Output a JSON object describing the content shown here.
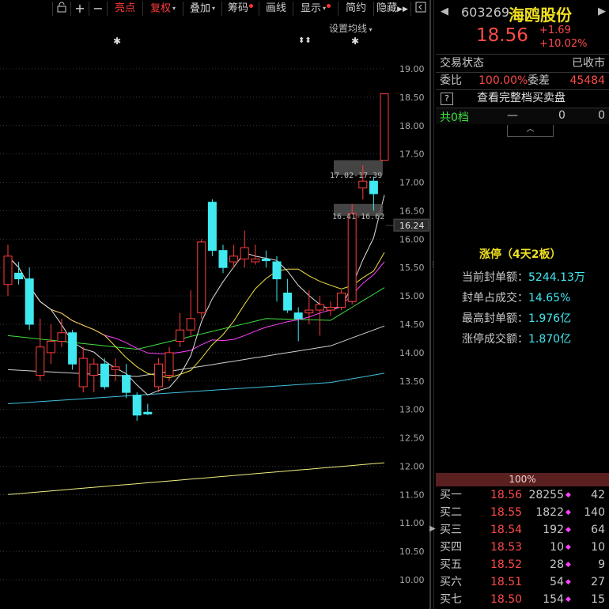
{
  "toolbar": {
    "items": [
      {
        "label": "亮点",
        "color": "red"
      },
      {
        "label": "复权",
        "color": "red",
        "caret": true
      },
      {
        "label": "叠加",
        "caret": true
      },
      {
        "label": "筹码",
        "dot": true
      },
      {
        "label": "画线"
      },
      {
        "label": "显示",
        "caret": true,
        "dot": true
      },
      {
        "label": "简约"
      },
      {
        "label": "隐藏"
      }
    ],
    "icons": [
      "lock-icon",
      "plus-icon",
      "minus-icon",
      "double-arrow-right-icon",
      "collapse-icon"
    ],
    "ma_settings": "设置均线"
  },
  "chart_data": {
    "type": "candlestick",
    "y_axis_ticks": [
      19.0,
      18.5,
      18.0,
      17.5,
      17.0,
      16.5,
      16.0,
      15.5,
      15.0,
      14.5,
      14.0,
      13.5,
      13.0,
      12.5,
      12.0,
      11.5,
      11.0,
      10.5,
      10.0
    ],
    "y_axis_labels": [
      "19.00",
      "18.50",
      "18.00",
      "17.50",
      "17.00",
      "16.50",
      "16.00",
      "15.50",
      "15.00",
      "14.50",
      "14.00",
      "13.50",
      "13.00",
      "12.50",
      "12.00",
      "11.50",
      "11.00",
      "10.50",
      "10.00"
    ],
    "current_price_label": "16.24",
    "ylim": [
      9.7,
      19.4
    ],
    "annotations": [
      {
        "text": "17.02-17.39"
      },
      {
        "text": "16.41-16.62"
      }
    ],
    "candles": [
      {
        "o": 15.2,
        "c": 15.7,
        "h": 15.9,
        "l": 15.0
      },
      {
        "o": 15.4,
        "c": 15.3,
        "h": 15.6,
        "l": 15.2
      },
      {
        "o": 15.3,
        "c": 14.5,
        "h": 15.5,
        "l": 14.4
      },
      {
        "o": 13.6,
        "c": 14.1,
        "h": 14.6,
        "l": 13.5
      },
      {
        "o": 14.0,
        "c": 14.2,
        "h": 14.5,
        "l": 13.8
      },
      {
        "o": 14.2,
        "c": 14.35,
        "h": 14.6,
        "l": 14.1
      },
      {
        "o": 14.35,
        "c": 13.8,
        "h": 14.4,
        "l": 13.7
      },
      {
        "o": 13.4,
        "c": 13.9,
        "h": 14.1,
        "l": 13.3
      },
      {
        "o": 13.6,
        "c": 13.8,
        "h": 13.9,
        "l": 13.3
      },
      {
        "o": 13.8,
        "c": 13.4,
        "h": 13.9,
        "l": 13.35
      },
      {
        "o": 13.7,
        "c": 13.75,
        "h": 13.9,
        "l": 13.5
      },
      {
        "o": 13.6,
        "c": 13.3,
        "h": 13.8,
        "l": 13.2
      },
      {
        "o": 13.25,
        "c": 12.9,
        "h": 13.3,
        "l": 12.8
      },
      {
        "o": 12.95,
        "c": 12.92,
        "h": 13.1,
        "l": 12.9
      },
      {
        "o": 13.4,
        "c": 13.8,
        "h": 13.9,
        "l": 13.3
      },
      {
        "o": 13.6,
        "c": 14.0,
        "h": 14.1,
        "l": 13.5
      },
      {
        "o": 14.2,
        "c": 14.4,
        "h": 14.7,
        "l": 14.1
      },
      {
        "o": 14.4,
        "c": 14.6,
        "h": 15.1,
        "l": 14.3
      },
      {
        "o": 14.7,
        "c": 15.95,
        "h": 16.0,
        "l": 14.6
      },
      {
        "o": 16.65,
        "c": 15.8,
        "h": 16.7,
        "l": 15.7
      },
      {
        "o": 15.8,
        "c": 15.5,
        "h": 15.9,
        "l": 15.4
      },
      {
        "o": 15.6,
        "c": 15.7,
        "h": 15.9,
        "l": 15.5
      },
      {
        "o": 15.65,
        "c": 15.85,
        "h": 16.15,
        "l": 15.5
      },
      {
        "o": 15.6,
        "c": 15.65,
        "h": 15.9,
        "l": 15.55
      },
      {
        "o": 15.65,
        "c": 15.62,
        "h": 15.8,
        "l": 15.5
      },
      {
        "o": 15.6,
        "c": 15.3,
        "h": 15.7,
        "l": 14.9
      },
      {
        "o": 15.05,
        "c": 14.75,
        "h": 15.3,
        "l": 14.7
      },
      {
        "o": 14.7,
        "c": 14.6,
        "h": 14.8,
        "l": 14.2
      },
      {
        "o": 14.7,
        "c": 14.75,
        "h": 15.1,
        "l": 14.5
      },
      {
        "o": 14.75,
        "c": 14.85,
        "h": 15.0,
        "l": 14.3
      },
      {
        "o": 14.75,
        "c": 14.8,
        "h": 14.9,
        "l": 14.65
      },
      {
        "o": 14.8,
        "c": 15.05,
        "h": 15.1,
        "l": 14.75
      },
      {
        "o": 14.9,
        "c": 16.45,
        "h": 16.62,
        "l": 14.85
      },
      {
        "o": 16.9,
        "c": 17.02,
        "h": 17.3,
        "l": 16.7
      },
      {
        "o": 17.02,
        "c": 16.8,
        "h": 17.1,
        "l": 16.5
      },
      {
        "o": 17.39,
        "c": 18.56,
        "h": 18.56,
        "l": 17.39
      }
    ],
    "gaps": [
      {
        "low": 17.13,
        "high": 17.39
      },
      {
        "low": 16.41,
        "high": 16.62
      }
    ]
  },
  "stock": {
    "code": "603269",
    "name": "海鸥股份",
    "price": "18.56",
    "change": "+1.69",
    "change_pct": "+10.02%"
  },
  "panel": {
    "trade_status_label": "交易状态",
    "trade_status_value": "已收市",
    "weibi_label": "委比",
    "weibi_value": "100.00%",
    "weicha_label": "委差",
    "weicha_value": "45484",
    "view_full_label": "查看完整档买卖盘",
    "ask_icon": "?",
    "total_label": "共0档",
    "total_dash": "—",
    "total_v1": "0",
    "total_v2": "0",
    "limit_title": "涨停（4天2板）",
    "stats": [
      {
        "k": "当前封单额：",
        "v": "5244.13万"
      },
      {
        "k": "封单占成交：",
        "v": "14.65%"
      },
      {
        "k": "最高封单额：",
        "v": "1.976亿"
      },
      {
        "k": "涨停成交额：",
        "v": "1.870亿"
      }
    ],
    "bar_pct": "100%",
    "bids": [
      {
        "name": "买一",
        "price": "18.56",
        "vol": "28255",
        "mark": "◆",
        "cnt": "42"
      },
      {
        "name": "买二",
        "price": "18.55",
        "vol": "1822",
        "mark": "◆",
        "cnt": "140"
      },
      {
        "name": "买三",
        "price": "18.54",
        "vol": "192",
        "mark": "◆",
        "cnt": "64"
      },
      {
        "name": "买四",
        "price": "18.53",
        "vol": "10",
        "mark": "◆",
        "cnt": "10"
      },
      {
        "name": "买五",
        "price": "18.52",
        "vol": "28",
        "mark": "◆",
        "cnt": "9"
      },
      {
        "name": "买六",
        "price": "18.51",
        "vol": "54",
        "mark": "◆",
        "cnt": "27"
      },
      {
        "name": "买七",
        "price": "18.50",
        "vol": "154",
        "mark": "◆",
        "cnt": "15"
      }
    ]
  },
  "colors": {
    "up": "#ff3c3c",
    "down": "#40e8f0",
    "ma5": "#e0e0e0",
    "ma10": "#f0e040",
    "ma20": "#ff40ff",
    "ma30": "#40e040",
    "ma60": "#d0d0d0",
    "ma120": "#40c0e0",
    "ma250": "#f0f080"
  }
}
